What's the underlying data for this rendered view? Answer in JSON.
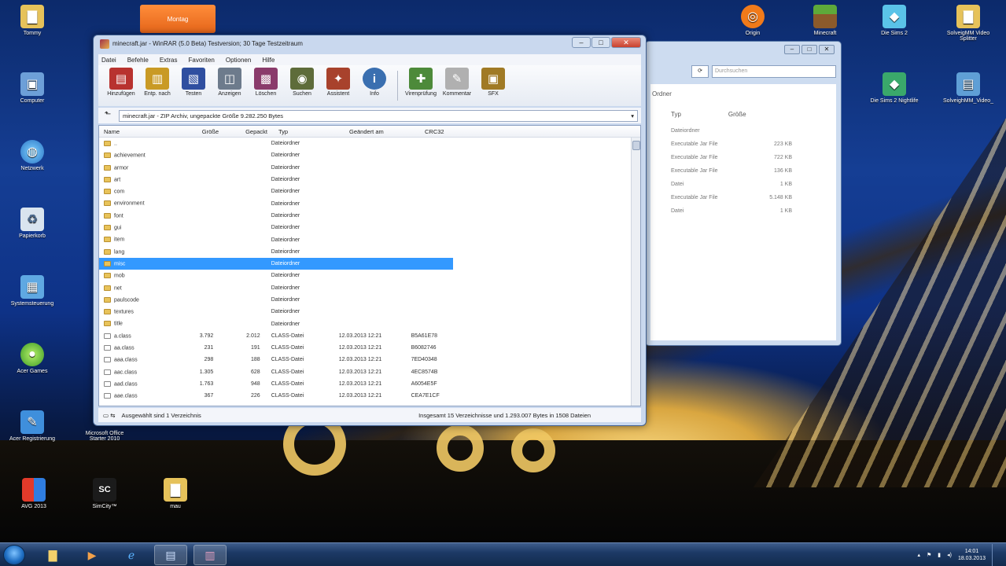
{
  "desktop": {
    "icons": [
      {
        "label": "Tommy",
        "glyph": "folder-icon"
      },
      {
        "label": "Computer",
        "glyph": "computer-icon"
      },
      {
        "label": "Netzwerk",
        "glyph": "network-icon"
      },
      {
        "label": "Papierkorb",
        "glyph": "recycle-bin-icon"
      },
      {
        "label": "Systemsteuerung",
        "glyph": "control-panel-icon"
      },
      {
        "label": "Acer Games",
        "glyph": "games-icon"
      },
      {
        "label": "Acer Registrierung",
        "glyph": "register-icon"
      },
      {
        "label": "AVG 2013",
        "glyph": "avg-icon"
      },
      {
        "label": "SimCity™",
        "glyph": "simcity-icon"
      },
      {
        "label": "mau",
        "glyph": "archive-icon"
      },
      {
        "label": "Microsoft Office Starter 2010",
        "glyph": "office-icon"
      },
      {
        "label": "Die Sims 2",
        "glyph": "sims-icon"
      },
      {
        "label": "Die Sims 2 Nightlife",
        "glyph": "sims-icon"
      },
      {
        "label": "Minecraft",
        "glyph": "minecraft-icon"
      },
      {
        "label": "SolveigMM Video Splitter",
        "glyph": "video-splitter-icon"
      },
      {
        "label": "SolveighMM_Video_",
        "glyph": "video-splitter-icon"
      },
      {
        "label": "Origin",
        "glyph": "origin-icon"
      }
    ],
    "calendar_widget": "Montag"
  },
  "explorer": {
    "search_placeholder": "Durchsuchen",
    "ordner_label": "Ordner",
    "col_type": "Typ",
    "col_size": "Größe",
    "rows": [
      {
        "type": "Dateiordner",
        "size": ""
      },
      {
        "type": "Executable Jar File",
        "size": "223 KB"
      },
      {
        "type": "Executable Jar File",
        "size": "722 KB"
      },
      {
        "type": "Executable Jar File",
        "size": "136 KB"
      },
      {
        "type": "Datei",
        "size": "1 KB"
      },
      {
        "type": "Executable Jar File",
        "size": "5.148 KB"
      },
      {
        "type": "Datei",
        "size": "1 KB"
      }
    ]
  },
  "winrar": {
    "title": "minecraft.jar - WinRAR (5.0 Beta) Testversion; 30 Tage Testzeitraum",
    "menu": [
      "Datei",
      "Befehle",
      "Extras",
      "Favoriten",
      "Optionen",
      "Hilfe"
    ],
    "tools": [
      {
        "label": "Hinzufügen",
        "icon": "add-icon",
        "color": "#b8322f"
      },
      {
        "label": "Entp. nach",
        "icon": "extract-icon",
        "color": "#c99a25"
      },
      {
        "label": "Testen",
        "icon": "test-icon",
        "color": "#2f4fa0"
      },
      {
        "label": "Anzeigen",
        "icon": "view-icon",
        "color": "#6d7b8c"
      },
      {
        "label": "Löschen",
        "icon": "delete-icon",
        "color": "#8a3b6b"
      },
      {
        "label": "Suchen",
        "icon": "find-icon",
        "color": "#5e6c3a"
      },
      {
        "label": "Assistent",
        "icon": "wizard-icon",
        "color": "#a8422c"
      },
      {
        "label": "Info",
        "icon": "info-icon",
        "color": "#3a6fb0"
      },
      {
        "label": "Virenprüfung",
        "icon": "virus-scan-icon",
        "color": "#4d8a3a"
      },
      {
        "label": "Kommentar",
        "icon": "comment-icon",
        "color": "#b0b0b0"
      },
      {
        "label": "SFX",
        "icon": "sfx-icon",
        "color": "#a07a25"
      }
    ],
    "path": "minecraft.jar - ZIP Archiv, ungepackte Größe 9.282.250 Bytes",
    "columns": {
      "name": "Name",
      "size": "Größe",
      "packed": "Gepackt",
      "type": "Typ",
      "modified": "Geändert am",
      "crc": "CRC32"
    },
    "rows": [
      {
        "name": "..",
        "size": "",
        "packed": "",
        "type": "Dateiordner",
        "date": "",
        "crc": "",
        "kind": "folder"
      },
      {
        "name": "achievement",
        "size": "",
        "packed": "",
        "type": "Dateiordner",
        "date": "",
        "crc": "",
        "kind": "folder"
      },
      {
        "name": "armor",
        "size": "",
        "packed": "",
        "type": "Dateiordner",
        "date": "",
        "crc": "",
        "kind": "folder"
      },
      {
        "name": "art",
        "size": "",
        "packed": "",
        "type": "Dateiordner",
        "date": "",
        "crc": "",
        "kind": "folder"
      },
      {
        "name": "com",
        "size": "",
        "packed": "",
        "type": "Dateiordner",
        "date": "",
        "crc": "",
        "kind": "folder"
      },
      {
        "name": "environment",
        "size": "",
        "packed": "",
        "type": "Dateiordner",
        "date": "",
        "crc": "",
        "kind": "folder"
      },
      {
        "name": "font",
        "size": "",
        "packed": "",
        "type": "Dateiordner",
        "date": "",
        "crc": "",
        "kind": "folder"
      },
      {
        "name": "gui",
        "size": "",
        "packed": "",
        "type": "Dateiordner",
        "date": "",
        "crc": "",
        "kind": "folder"
      },
      {
        "name": "item",
        "size": "",
        "packed": "",
        "type": "Dateiordner",
        "date": "",
        "crc": "",
        "kind": "folder"
      },
      {
        "name": "lang",
        "size": "",
        "packed": "",
        "type": "Dateiordner",
        "date": "",
        "crc": "",
        "kind": "folder"
      },
      {
        "name": "misc",
        "size": "",
        "packed": "",
        "type": "Dateiordner",
        "date": "",
        "crc": "",
        "kind": "folder",
        "selected": true
      },
      {
        "name": "mob",
        "size": "",
        "packed": "",
        "type": "Dateiordner",
        "date": "",
        "crc": "",
        "kind": "folder"
      },
      {
        "name": "net",
        "size": "",
        "packed": "",
        "type": "Dateiordner",
        "date": "",
        "crc": "",
        "kind": "folder"
      },
      {
        "name": "paulscode",
        "size": "",
        "packed": "",
        "type": "Dateiordner",
        "date": "",
        "crc": "",
        "kind": "folder"
      },
      {
        "name": "textures",
        "size": "",
        "packed": "",
        "type": "Dateiordner",
        "date": "",
        "crc": "",
        "kind": "folder"
      },
      {
        "name": "title",
        "size": "",
        "packed": "",
        "type": "Dateiordner",
        "date": "",
        "crc": "",
        "kind": "folder"
      },
      {
        "name": "a.class",
        "size": "3.792",
        "packed": "2.012",
        "type": "CLASS-Datei",
        "date": "12.03.2013 12:21",
        "crc": "B5A61E78",
        "kind": "file"
      },
      {
        "name": "aa.class",
        "size": "231",
        "packed": "191",
        "type": "CLASS-Datei",
        "date": "12.03.2013 12:21",
        "crc": "B6082746",
        "kind": "file"
      },
      {
        "name": "aaa.class",
        "size": "298",
        "packed": "188",
        "type": "CLASS-Datei",
        "date": "12.03.2013 12:21",
        "crc": "7ED40348",
        "kind": "file"
      },
      {
        "name": "aac.class",
        "size": "1.305",
        "packed": "628",
        "type": "CLASS-Datei",
        "date": "12.03.2013 12:21",
        "crc": "4EC8574B",
        "kind": "file"
      },
      {
        "name": "aad.class",
        "size": "1.763",
        "packed": "948",
        "type": "CLASS-Datei",
        "date": "12.03.2013 12:21",
        "crc": "A6054E5F",
        "kind": "file"
      },
      {
        "name": "aae.class",
        "size": "367",
        "packed": "226",
        "type": "CLASS-Datei",
        "date": "12.03.2013 12:21",
        "crc": "CEA7E1CF",
        "kind": "file"
      }
    ],
    "status_left": "Ausgewählt sind 1 Verzeichnis",
    "status_right": "Insgesamt 15 Verzeichnisse und 1.293.007 Bytes in 1508 Dateien"
  },
  "taskbar": {
    "clock_time": "14:01",
    "clock_date": "18.03.2013"
  }
}
